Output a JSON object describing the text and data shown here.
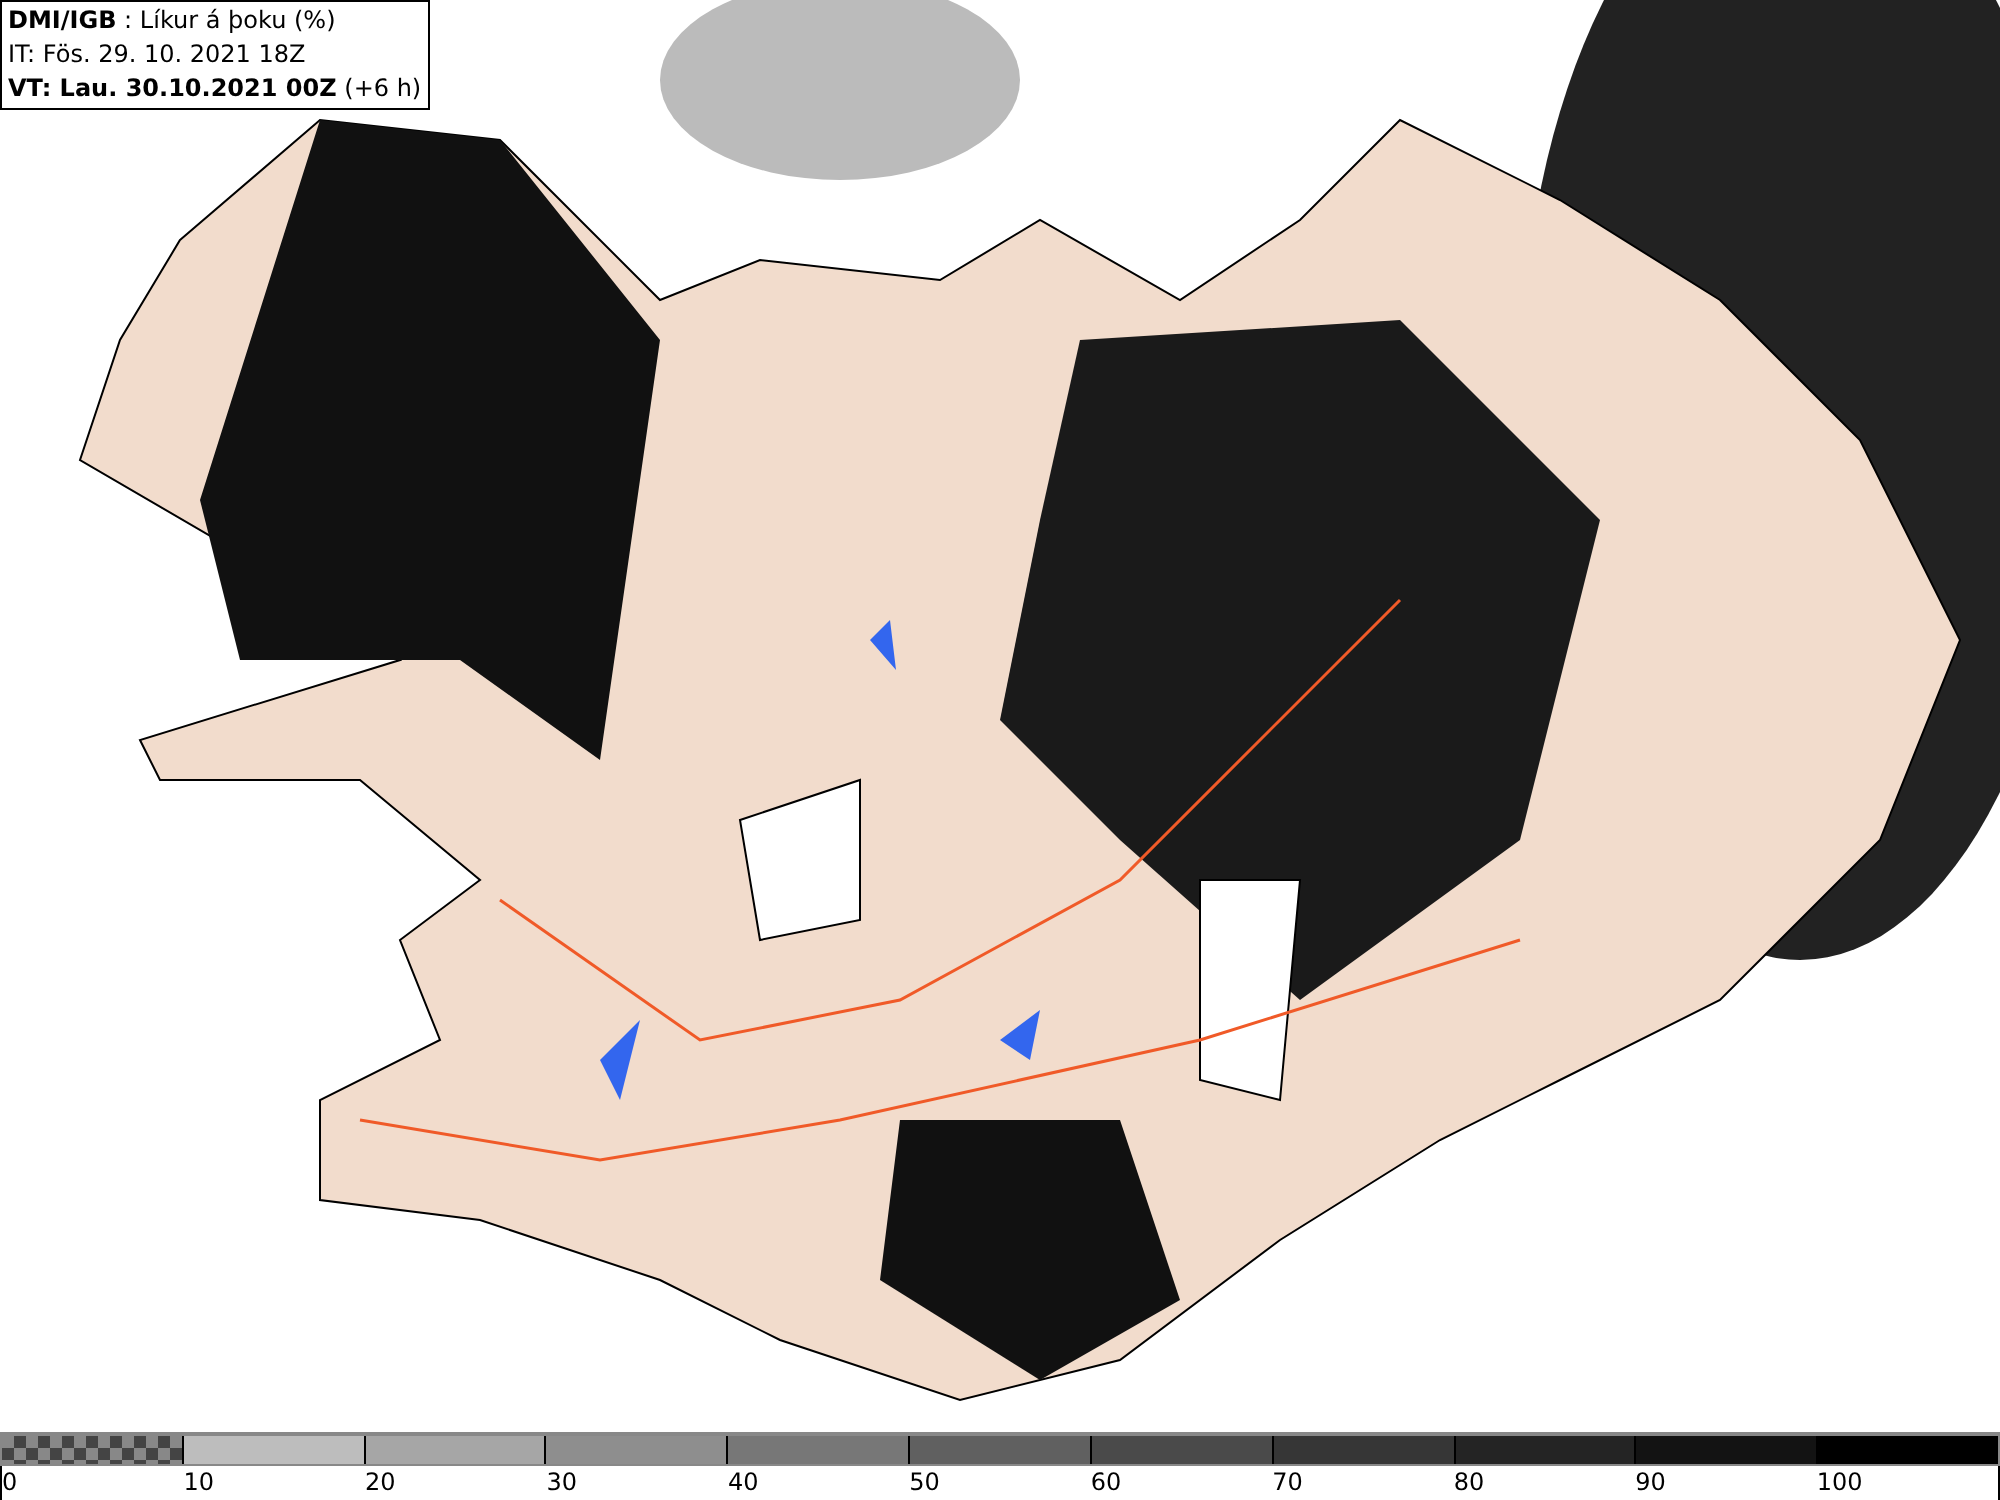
{
  "header": {
    "source": "DMI/IGB",
    "separator": ":",
    "product": "Líkur á þoku (%)",
    "issue_time": "IT: Fös. 29. 10. 2021 18Z",
    "valid_label": "VT: Lau. 30.10.2021 00Z",
    "offset": "(+6 h)"
  },
  "legend": [
    {
      "label": "0",
      "kind": "checker"
    },
    {
      "label": "10",
      "kind": "solid",
      "color": "#bdbdbd"
    },
    {
      "label": "20",
      "kind": "solid",
      "color": "#a6a6a6"
    },
    {
      "label": "30",
      "kind": "solid",
      "color": "#8e8e8e"
    },
    {
      "label": "40",
      "kind": "solid",
      "color": "#777777"
    },
    {
      "label": "50",
      "kind": "solid",
      "color": "#606060"
    },
    {
      "label": "60",
      "kind": "solid",
      "color": "#4a4a4a"
    },
    {
      "label": "70",
      "kind": "solid",
      "color": "#363636"
    },
    {
      "label": "80",
      "kind": "solid",
      "color": "#242424"
    },
    {
      "label": "90",
      "kind": "solid",
      "color": "#131313"
    },
    {
      "label": "100",
      "kind": "solid",
      "color": "#000000"
    }
  ]
}
